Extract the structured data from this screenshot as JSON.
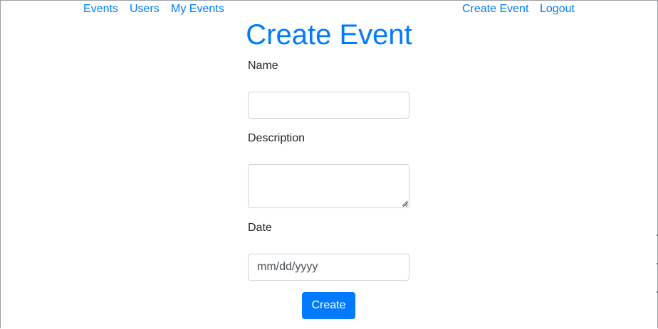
{
  "nav": {
    "events": "Events",
    "users": "Users",
    "my_events": "My Events",
    "create_event": "Create Event",
    "logout": "Logout"
  },
  "page": {
    "title": "Create Event"
  },
  "form": {
    "name_label": "Name",
    "name_value": "",
    "description_label": "Description",
    "description_value": "",
    "date_label": "Date",
    "date_placeholder": "mm/dd/yyyy",
    "submit_label": "Create"
  },
  "colors": {
    "accent": "#007bff",
    "text": "#212529",
    "input_border": "#ced4da"
  }
}
